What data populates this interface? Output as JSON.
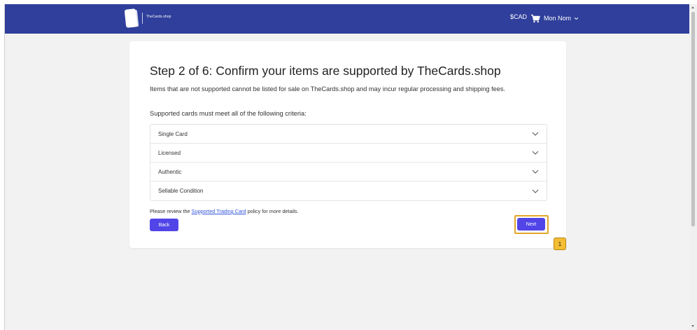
{
  "header": {
    "logo_text": "TheCards.shop",
    "currency": "$CAD",
    "user_name": "Mon Nom"
  },
  "main": {
    "title": "Step 2 of 6: Confirm your items are supported by TheCards.shop",
    "description": "Items that are not supported cannot be listed for sale on TheCards.shop and may incur regular processing and shipping fees.",
    "criteria_intro": "Supported cards must meet all of the following criteria:",
    "criteria": [
      {
        "label": "Single Card"
      },
      {
        "label": "Licensed"
      },
      {
        "label": "Authentic"
      },
      {
        "label": "Sellable Condition"
      }
    ],
    "policy_prefix": "Please review the",
    "policy_link": "Supported Trading Card",
    "policy_suffix": "policy for more details.",
    "back_label": "Back",
    "next_label": "Next"
  },
  "annotation": {
    "marker_label": "1",
    "highlight_color": "#e1a62a"
  },
  "colors": {
    "header_bg": "#2f3f9b",
    "button_bg": "#5145e8",
    "link": "#2f53d9",
    "page_bg": "#f2f2f2"
  },
  "icons": [
    "cards-logo-icon",
    "cart-icon",
    "chevron-down-icon"
  ]
}
